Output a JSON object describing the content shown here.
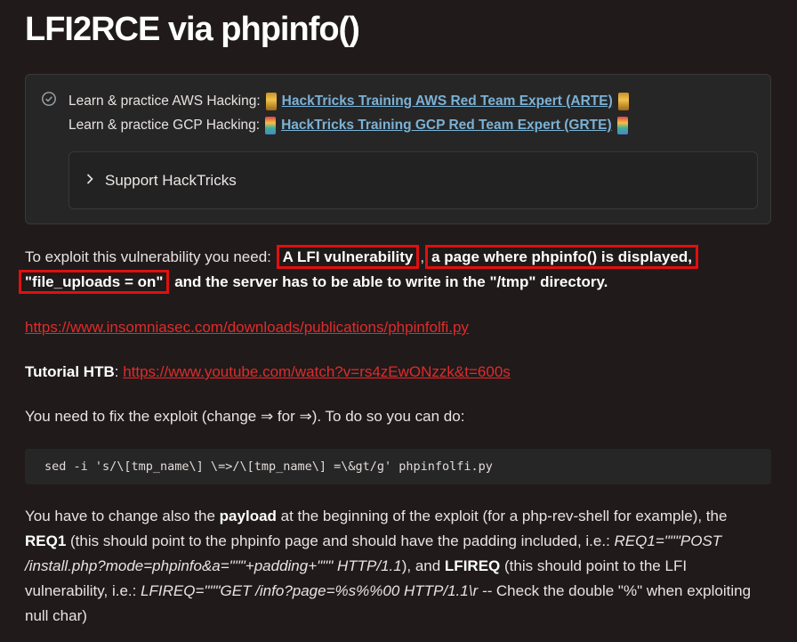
{
  "title": "LFI2RCE via phpinfo()",
  "hint": {
    "icon": "check-circle-icon",
    "line1_prefix": "Learn & practice AWS Hacking:",
    "line1_link": "HackTricks Training AWS Red Team Expert (ARTE)",
    "line2_prefix": "Learn & practice GCP Hacking:",
    "line2_link": "HackTricks Training GCP Red Team Expert (GRTE)",
    "details_label": "Support HackTricks"
  },
  "p1": {
    "prefix": "To exploit this vulnerability you need:",
    "req1": "A LFI vulnerability",
    "sep1": ",",
    "req2": "a page where phpinfo() is displayed,",
    "req3": "\"file_uploads = on\"",
    "suffix": "and the server has to be able to write in the \"/tmp\" directory."
  },
  "link1": "https://www.insomniasec.com/downloads/publications/phpinfolfi.py",
  "tutorial": {
    "label": "Tutorial HTB",
    "colon": ":",
    "link": "https://www.youtube.com/watch?v=rs4zEwONzzk&t=600s"
  },
  "p2": "You need to fix the exploit (change ⇒ for ⇒). To do so you can do:",
  "code": "sed -i 's/\\[tmp_name\\] \\=>/\\[tmp_name\\] =\\&gt/g' phpinfolfi.py",
  "p3": {
    "t1": "You have to change also the ",
    "b1": "payload",
    "t2": " at the beginning of the exploit (for a php-rev-shell for example), the ",
    "b2": "REQ1",
    "t3": " (this should point to the phpinfo page and should have the padding included, i.e.: ",
    "i1": "REQ1=\"\"\"POST /install.php?mode=phpinfo&a=\"\"\"+padding+\"\"\" HTTP/1.1",
    "t4": "), and ",
    "b3": "LFIREQ",
    "t5": " (this should point to the LFI vulnerability, i.e.: ",
    "i2": "LFIREQ=\"\"\"GET /info?page=%s%%00 HTTP/1.1\\r --",
    "t6": " Check the double \"%\" when exploiting null char)"
  }
}
